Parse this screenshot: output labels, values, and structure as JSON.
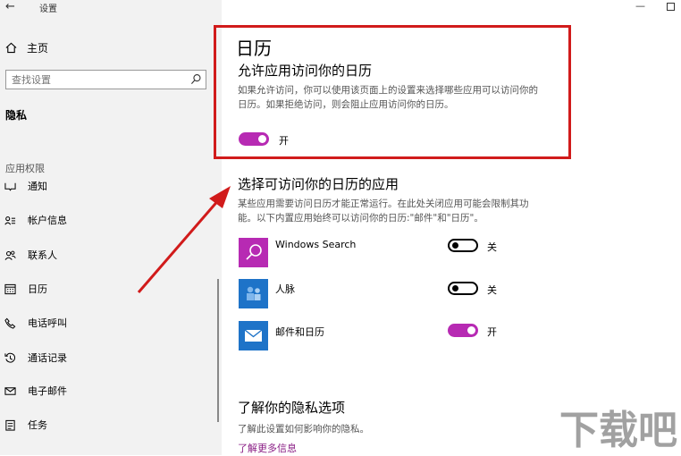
{
  "titlebar": {
    "back_glyph": "←",
    "title": "设置",
    "minimize_glyph": "—"
  },
  "sidebar": {
    "home_label": "主页",
    "search_placeholder": "查找设置",
    "section_privacy": "隐私",
    "section_app_permissions": "应用权限",
    "items": [
      {
        "label": "通知",
        "icon": "notification-icon"
      },
      {
        "label": "帐户信息",
        "icon": "account-info-icon"
      },
      {
        "label": "联系人",
        "icon": "contacts-icon"
      },
      {
        "label": "日历",
        "icon": "calendar-icon"
      },
      {
        "label": "电话呼叫",
        "icon": "phone-icon"
      },
      {
        "label": "通话记录",
        "icon": "call-history-icon"
      },
      {
        "label": "电子邮件",
        "icon": "email-icon"
      },
      {
        "label": "任务",
        "icon": "tasks-icon"
      }
    ]
  },
  "main": {
    "page_title": "日历",
    "allow_heading": "允许应用访问你的日历",
    "allow_desc_line1": "如果允许访问，你可以使用该页面上的设置来选择哪些应用可以访问你的",
    "allow_desc_line2": "日历。如果拒绝访问，则会阻止应用访问你的日历。",
    "allow_toggle": {
      "state": "on",
      "label": "开"
    },
    "choose_heading": "选择可访问你的日历的应用",
    "choose_desc_line1": "某些应用需要访问日历才能正常运行。在此处关闭应用可能会限制其功",
    "choose_desc_line2": "能。以下内置应用始终可以访问你的日历:\"邮件\"和\"日历\"。",
    "apps": [
      {
        "name": "Windows Search",
        "toggle_state": "off",
        "toggle_label": "关",
        "tile_color": "#b72ab3",
        "icon": "search-icon"
      },
      {
        "name": "人脉",
        "toggle_state": "off",
        "toggle_label": "关",
        "tile_color": "#1e73c8",
        "icon": "people-icon"
      },
      {
        "name": "邮件和日历",
        "toggle_state": "on",
        "toggle_label": "开",
        "tile_color": "#1e73c8",
        "icon": "mail-icon"
      }
    ],
    "privacy_heading": "了解你的隐私选项",
    "privacy_desc": "了解此设置如何影响你的隐私。",
    "learn_more_link": "了解更多信息"
  },
  "colors": {
    "accent": "#b72ab3",
    "annotation_red": "#d11b1b",
    "app_blue": "#1e73c8"
  },
  "watermark_text": "下载吧"
}
